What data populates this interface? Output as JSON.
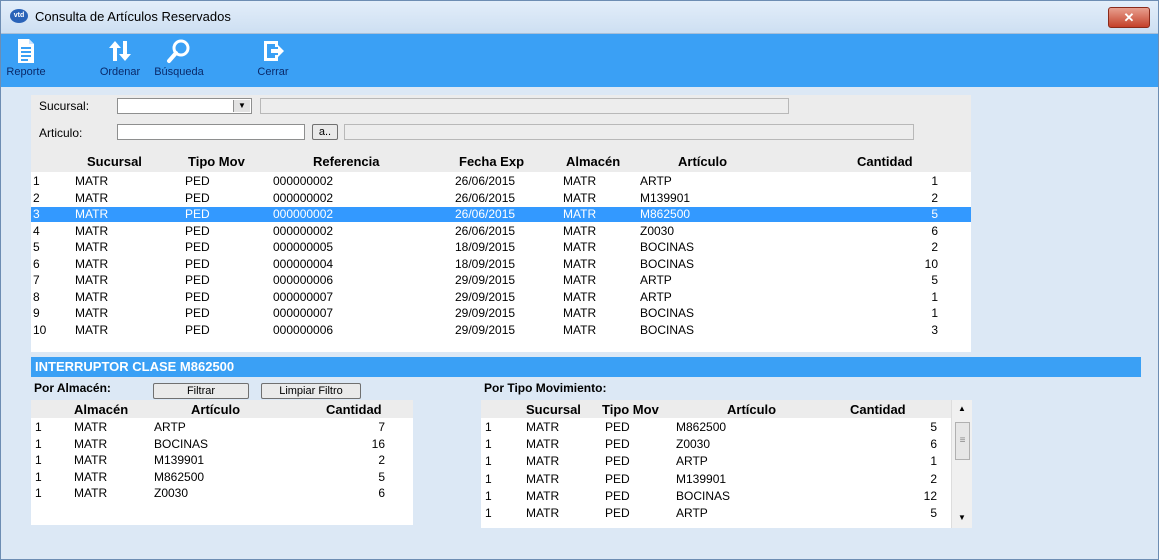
{
  "window": {
    "title": "Consulta de Artículos Reservados",
    "icon": "vtd",
    "close": "✕"
  },
  "toolbar": [
    {
      "label": "Reporte",
      "icon": "report-icon"
    },
    {
      "label": "Ordenar",
      "icon": "sort-icon"
    },
    {
      "label": "Búsqueda",
      "icon": "search-icon"
    },
    {
      "label": "Cerrar",
      "icon": "exit-icon"
    }
  ],
  "filters": {
    "sucursal_label": "Sucursal:",
    "sucursal_value": "",
    "sucursal_desc": "",
    "articulo_label": "Articulo:",
    "articulo_value": "",
    "articulo_lookup": "a..",
    "articulo_desc": ""
  },
  "main_grid": {
    "headers": [
      "Sucursal",
      "Tipo Mov",
      "Referencia",
      "Fecha Exp",
      "Almacén",
      "Artículo",
      "Cantidad"
    ],
    "selected_index": 2,
    "rows": [
      [
        "1",
        "MATR",
        "PED",
        "000000002",
        "26/06/2015",
        "MATR",
        "ARTP",
        "1"
      ],
      [
        "2",
        "MATR",
        "PED",
        "000000002",
        "26/06/2015",
        "MATR",
        "M139901",
        "2"
      ],
      [
        "3",
        "MATR",
        "PED",
        "000000002",
        "26/06/2015",
        "MATR",
        "M862500",
        "5"
      ],
      [
        "4",
        "MATR",
        "PED",
        "000000002",
        "26/06/2015",
        "MATR",
        "Z0030",
        "6"
      ],
      [
        "5",
        "MATR",
        "PED",
        "000000005",
        "18/09/2015",
        "MATR",
        "BOCINAS",
        "2"
      ],
      [
        "6",
        "MATR",
        "PED",
        "000000004",
        "18/09/2015",
        "MATR",
        "BOCINAS",
        "10"
      ],
      [
        "7",
        "MATR",
        "PED",
        "000000006",
        "29/09/2015",
        "MATR",
        "ARTP",
        "5"
      ],
      [
        "8",
        "MATR",
        "PED",
        "000000007",
        "29/09/2015",
        "MATR",
        "ARTP",
        "1"
      ],
      [
        "9",
        "MATR",
        "PED",
        "000000007",
        "29/09/2015",
        "MATR",
        "BOCINAS",
        "1"
      ],
      [
        "10",
        "MATR",
        "PED",
        "000000006",
        "29/09/2015",
        "MATR",
        "BOCINAS",
        "3"
      ]
    ]
  },
  "info_bar": "INTERRUPTOR CLASE M862500",
  "almacen_section": {
    "label": "Por Almacén:",
    "filter_button": "Filtrar",
    "clear_button": "Limpiar Filtro",
    "headers": [
      "Almacén",
      "Artículo",
      "Cantidad"
    ],
    "rows": [
      [
        "1",
        "MATR",
        "ARTP",
        "7"
      ],
      [
        "1",
        "MATR",
        "BOCINAS",
        "16"
      ],
      [
        "1",
        "MATR",
        "M139901",
        "2"
      ],
      [
        "1",
        "MATR",
        "M862500",
        "5"
      ],
      [
        "1",
        "MATR",
        "Z0030",
        "6"
      ]
    ]
  },
  "tipo_section": {
    "label": "Por Tipo Movimiento:",
    "headers": [
      "Sucursal",
      "Tipo Mov",
      "Artículo",
      "Cantidad"
    ],
    "rows": [
      [
        "1",
        "MATR",
        "PED",
        "M862500",
        "5"
      ],
      [
        "1",
        "MATR",
        "PED",
        "Z0030",
        "6"
      ],
      [
        "1",
        "MATR",
        "PED",
        "ARTP",
        "1"
      ],
      [
        "1",
        "MATR",
        "PED",
        "M139901",
        "2"
      ],
      [
        "1",
        "MATR",
        "PED",
        "BOCINAS",
        "12"
      ],
      [
        "1",
        "MATR",
        "PED",
        "ARTP",
        "5"
      ]
    ],
    "scroll_up": "▲",
    "scroll_down": "▼",
    "scroll_grip": "≡"
  }
}
